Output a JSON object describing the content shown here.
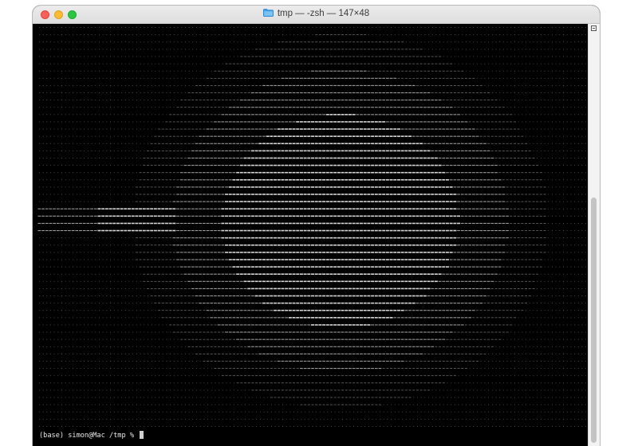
{
  "window": {
    "title": "tmp — -zsh — 147×48",
    "title_icon": "folder-icon"
  },
  "terminal": {
    "background": "#000000",
    "foreground": "#e8e8e8",
    "art_description_icon": "ascii-art",
    "art_charset": ".:-=+*#%@",
    "prompt": "(base) simon@Mac /tmp % "
  },
  "scrollbar": {
    "position_fraction": 0.42
  }
}
